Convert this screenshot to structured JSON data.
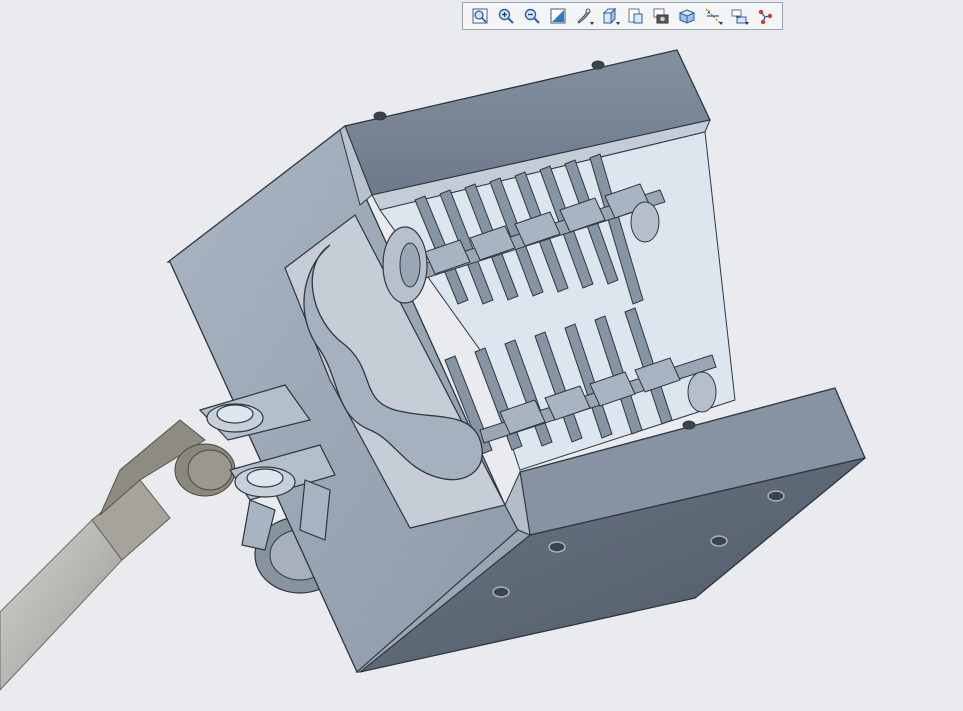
{
  "toolbar": {
    "buttons": [
      {
        "name": "refit-icon",
        "dropdown": false
      },
      {
        "name": "zoom-in-icon",
        "dropdown": false
      },
      {
        "name": "zoom-out-icon",
        "dropdown": false
      },
      {
        "name": "repaint-icon",
        "dropdown": false
      },
      {
        "name": "display-style-icon",
        "dropdown": true
      },
      {
        "name": "saved-orientations-icon",
        "dropdown": true
      },
      {
        "name": "view-manager-icon",
        "dropdown": false
      },
      {
        "name": "snapshot-icon",
        "dropdown": false
      },
      {
        "name": "section-view-icon",
        "dropdown": false
      },
      {
        "name": "datum-display-icon",
        "dropdown": true
      },
      {
        "name": "annotation-display-icon",
        "dropdown": true
      },
      {
        "name": "spin-center-icon",
        "dropdown": false
      }
    ]
  },
  "colors": {
    "background": "#e9ebee",
    "metal_light": "#a9b4c2",
    "metal_mid": "#8d99a8",
    "metal_dark": "#5d6876",
    "edge": "#2e3640",
    "rod": "#b9b9b6",
    "knob": "#8b887f"
  }
}
